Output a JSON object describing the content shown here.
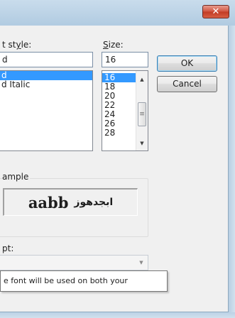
{
  "titlebar": {
    "close_glyph": "✕"
  },
  "font_style": {
    "label_before": "t st",
    "label_mnemonic": "y",
    "label_after": "le:",
    "value": "d",
    "items": [
      {
        "label": "d",
        "selected": true
      },
      {
        "label": "d Italic",
        "selected": false
      }
    ]
  },
  "size": {
    "label_mnemonic": "S",
    "label_after": "ize:",
    "value": "16",
    "items": [
      {
        "label": "16",
        "selected": true
      },
      {
        "label": "18",
        "selected": false
      },
      {
        "label": "20",
        "selected": false
      },
      {
        "label": "22",
        "selected": false
      },
      {
        "label": "24",
        "selected": false
      },
      {
        "label": "26",
        "selected": false
      },
      {
        "label": "28",
        "selected": false
      }
    ]
  },
  "buttons": {
    "ok": "OK",
    "cancel": "Cancel"
  },
  "sample": {
    "label": "ample",
    "latin": "aabb",
    "arabic": "ابجدهوز"
  },
  "script": {
    "label": "pt:",
    "value": ""
  },
  "tooltip": {
    "text": "e font will be used on both your"
  },
  "icons": {
    "scroll_up": "▲",
    "scroll_down": "▼",
    "thumb_grip": "≡",
    "combo_arrow": "▼"
  }
}
